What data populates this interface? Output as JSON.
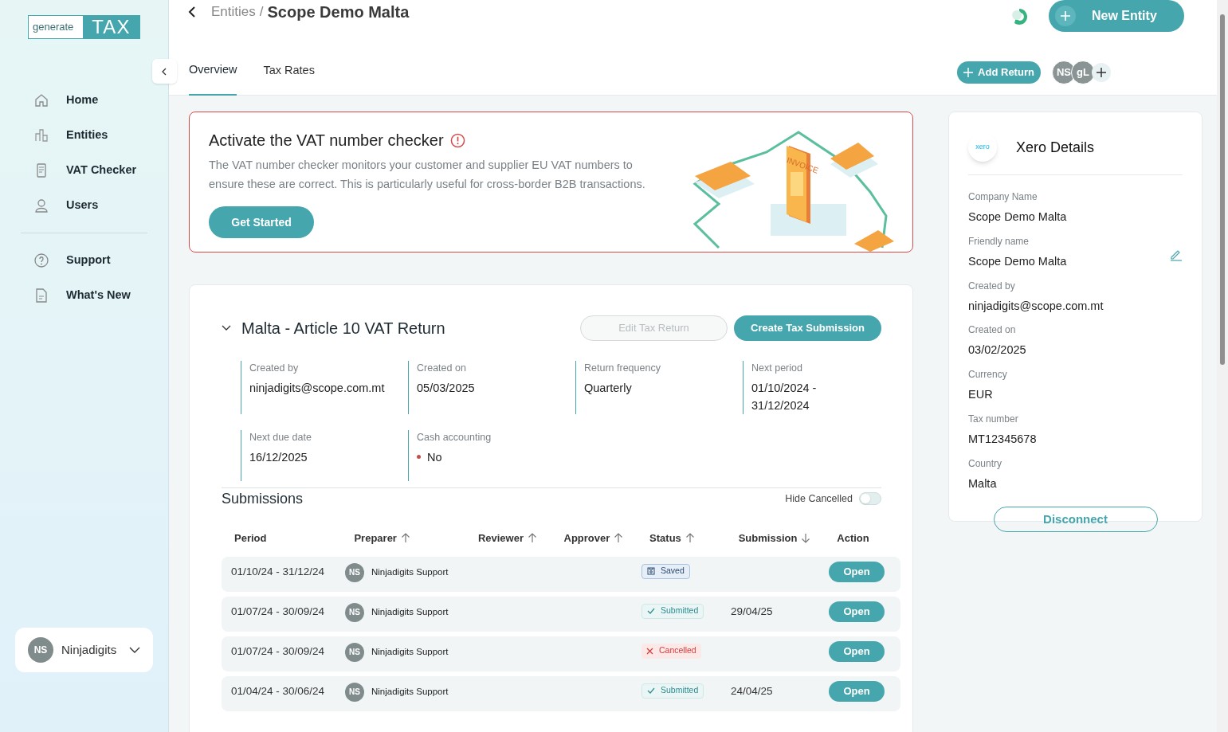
{
  "logo": {
    "left": "generate",
    "right": "TAX"
  },
  "sidebar": {
    "items": [
      {
        "label": "Home",
        "selected": false
      },
      {
        "label": "Entities",
        "selected": false
      },
      {
        "label": "VAT Checker",
        "selected": false
      },
      {
        "label": "Users",
        "selected": false
      }
    ],
    "secondary_items": [
      {
        "label": "Support"
      },
      {
        "label": "What's New"
      }
    ],
    "account": {
      "initials": "NS",
      "name": "Ninjadigits"
    }
  },
  "header": {
    "breadcrumb_parent": "Entities",
    "separator": "/",
    "title": "Scope Demo Malta",
    "new_entity_button": "New Entity",
    "tabs": [
      {
        "label": "Overview",
        "selected": true
      },
      {
        "label": "Tax Rates",
        "selected": false
      }
    ],
    "add_return_button": "Add Return",
    "avatars": [
      "NS",
      "gL"
    ]
  },
  "banner": {
    "title": "Activate the VAT number checker",
    "text": "The VAT number checker monitors your customer and supplier EU VAT numbers to ensure these are correct. This is particularly useful for cross-border B2B transactions.",
    "button": "Get Started",
    "illustration_label": "INVOICE"
  },
  "return": {
    "title": "Malta - Article 10 VAT Return",
    "expanded": true,
    "edit_button": {
      "label": "Edit Tax Return",
      "disabled": true
    },
    "create_button": "Create Tax Submission",
    "fields": [
      {
        "label": "Created by",
        "value": "ninjadigits@scope.com.mt"
      },
      {
        "label": "Created on",
        "value": "05/03/2025"
      },
      {
        "label": "Return frequency",
        "value": "Quarterly"
      },
      {
        "label": "Next period",
        "value": "01/10/2024 - 31/12/2024"
      },
      {
        "label": "Next due date",
        "value": "16/12/2025"
      },
      {
        "label": "Cash accounting",
        "value": "No",
        "color": "#c0504d"
      }
    ]
  },
  "submissions": {
    "title": "Submissions",
    "hide_cancelled": {
      "label": "Hide Cancelled",
      "on": false
    },
    "columns": [
      {
        "label": "Period",
        "sortable": false
      },
      {
        "label": "Preparer",
        "sortable": true,
        "ascending": true
      },
      {
        "label": "Reviewer",
        "sortable": true,
        "ascending": true
      },
      {
        "label": "Approver",
        "sortable": true,
        "ascending": true
      },
      {
        "label": "Status",
        "sortable": true,
        "ascending": true
      },
      {
        "label": "Submission",
        "sortable": true,
        "ascending": false
      },
      {
        "label": "Action",
        "sortable": false
      }
    ],
    "rows": [
      {
        "period": "01/10/24 - 31/12/24",
        "preparer_initials": "NS",
        "preparer": "Ninjadigits Support",
        "status": "Saved",
        "kind": "saved",
        "submission": "",
        "action": "Open"
      },
      {
        "period": "01/07/24 - 30/09/24",
        "preparer_initials": "NS",
        "preparer": "Ninjadigits Support",
        "status": "Submitted",
        "kind": "submitted",
        "submission": "29/04/25",
        "action": "Open"
      },
      {
        "period": "01/07/24 - 30/09/24",
        "preparer_initials": "NS",
        "preparer": "Ninjadigits Support",
        "status": "Cancelled",
        "kind": "cancelled",
        "submission": "",
        "action": "Open"
      },
      {
        "period": "01/04/24 - 30/06/24",
        "preparer_initials": "NS",
        "preparer": "Ninjadigits Support",
        "status": "Submitted",
        "kind": "submitted",
        "submission": "24/04/25",
        "action": "Open"
      }
    ]
  },
  "xero": {
    "logo": "xero",
    "title": "Xero Details",
    "fields": [
      {
        "label": "Company Name",
        "value": "Scope Demo Malta",
        "editable": false
      },
      {
        "label": "Friendly name",
        "value": "Scope Demo Malta",
        "editable": true
      },
      {
        "label": "Created by",
        "value": "ninjadigits@scope.com.mt",
        "editable": false
      },
      {
        "label": "Created on",
        "value": "03/02/2025",
        "editable": false
      },
      {
        "label": "Currency",
        "value": "EUR",
        "editable": false
      },
      {
        "label": "Tax number",
        "value": "MT12345678",
        "editable": false
      },
      {
        "label": "Country",
        "value": "Malta",
        "editable": false
      }
    ],
    "button": "Disconnect"
  }
}
